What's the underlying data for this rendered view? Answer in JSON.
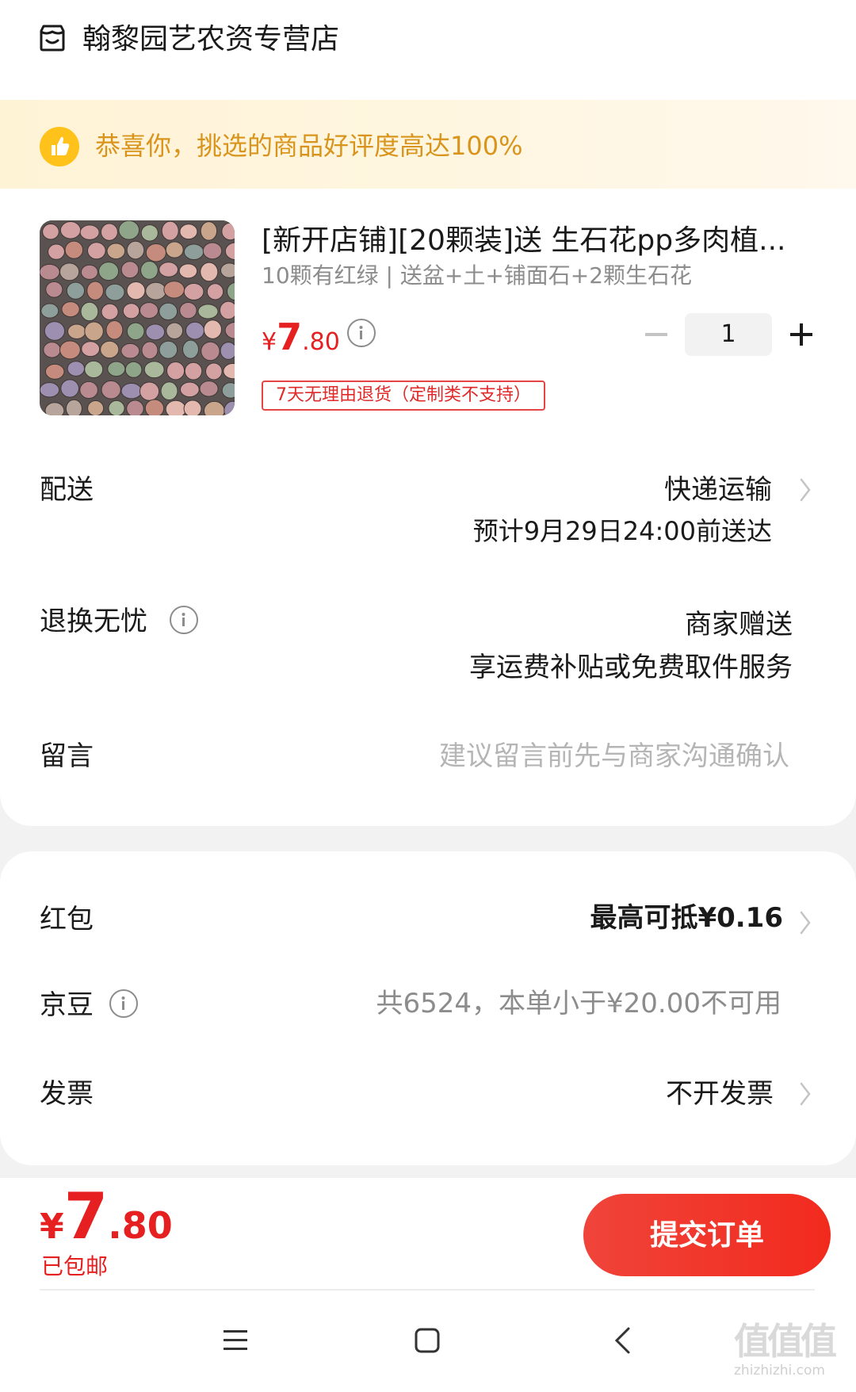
{
  "store": {
    "name": "翰黎园艺农资专营店",
    "icon": "store-icon"
  },
  "banner": {
    "text": "恭喜你，挑选的商品好评度高达100%",
    "icon": "thumbs-up-icon",
    "accent": "#d9941c"
  },
  "product": {
    "title": "[新开店铺][20颗装]送 生石花pp多肉植...",
    "subtitle": "10颗有红绿 | 送盆+土+铺面石+2颗生石花",
    "price_symbol": "¥",
    "price_int": "7",
    "price_dec": ".80",
    "quantity": "1",
    "return_tag": "7天无理由退货（定制类不支持）"
  },
  "delivery": {
    "label": "配送",
    "method": "快递运输",
    "eta": "预计9月29日24:00前送达"
  },
  "returns": {
    "label": "退换无忧",
    "value1": "商家赠送",
    "value2": "享运费补贴或免费取件服务"
  },
  "message": {
    "label": "留言",
    "placeholder": "建议留言前先与商家沟通确认"
  },
  "red_packet": {
    "label": "红包",
    "value": "最高可抵¥0.16"
  },
  "jingdou": {
    "label": "京豆",
    "value": "共6524，本单小于¥20.00不可用"
  },
  "invoice": {
    "label": "发票",
    "value": "不开发票"
  },
  "footer": {
    "price_symbol": "¥",
    "price_int": "7",
    "price_dec": ".80",
    "shipping": "已包邮",
    "submit": "提交订单"
  },
  "watermark": {
    "line1": "值值值",
    "line2": "zhizhizhi.com"
  },
  "colors": {
    "brand_red": "#e62020",
    "banner_bg": "#fff3d6",
    "page_bg": "#f2f2f2"
  }
}
